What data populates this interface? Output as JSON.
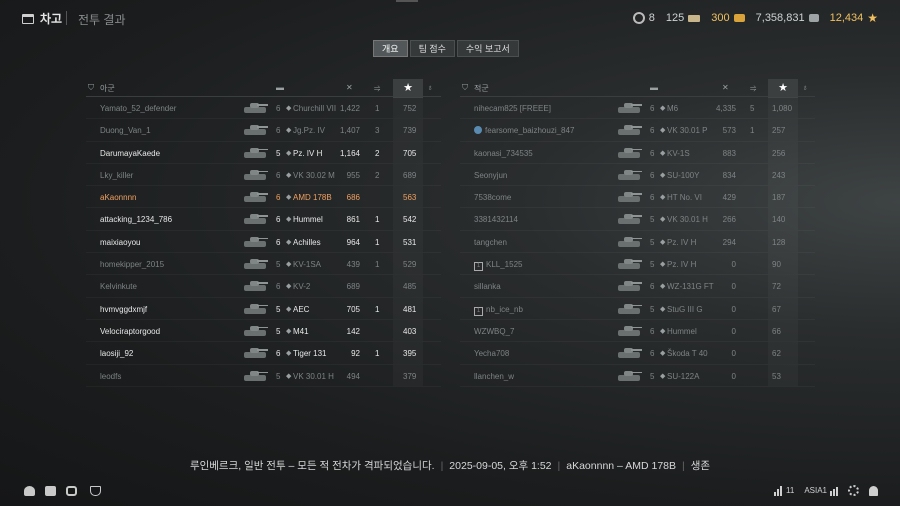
{
  "header": {
    "hangar_label": "차고",
    "breadcrumb": "전투 결과",
    "boosters": "8",
    "bonds": "125",
    "gold": "300",
    "credits": "7,358,831",
    "free_xp": "12,434"
  },
  "tabs": [
    {
      "label": "개요",
      "active": true
    },
    {
      "label": "팀 점수",
      "active": false
    },
    {
      "label": "수익 보고서",
      "active": false
    }
  ],
  "ally": {
    "title": "아군",
    "rows": [
      {
        "name": "Yamato_52_defender",
        "tier": "6",
        "tank": "Churchill VII",
        "damage": "1,422",
        "kills": "1",
        "xp": "752",
        "style": "dim"
      },
      {
        "name": "Duong_Van_1",
        "tier": "6",
        "tank": "Jg.Pz. IV",
        "damage": "1,407",
        "kills": "3",
        "xp": "739",
        "style": "dim"
      },
      {
        "name": "DarumayaKaede",
        "tier": "5",
        "tank": "Pz. IV H",
        "damage": "1,164",
        "kills": "2",
        "xp": "705",
        "style": "bright"
      },
      {
        "name": "Lky_killer",
        "tier": "6",
        "tank": "VK 30.02 M",
        "damage": "955",
        "kills": "2",
        "xp": "689",
        "style": "dim"
      },
      {
        "name": "aKaonnnn",
        "tier": "6",
        "tank": "AMD 178B",
        "damage": "686",
        "kills": "",
        "xp": "563",
        "style": "me"
      },
      {
        "name": "attacking_1234_786",
        "tier": "6",
        "tank": "Hummel",
        "damage": "861",
        "kills": "1",
        "xp": "542",
        "style": "bright"
      },
      {
        "name": "maixiaoyou",
        "tier": "6",
        "tank": "Achilles",
        "damage": "964",
        "kills": "1",
        "xp": "531",
        "style": "bright"
      },
      {
        "name": "homekipper_2015",
        "tier": "5",
        "tank": "KV-1SA",
        "damage": "439",
        "kills": "1",
        "xp": "529",
        "style": "dim"
      },
      {
        "name": "Kelvinkute",
        "tier": "6",
        "tank": "KV-2",
        "damage": "689",
        "kills": "",
        "xp": "485",
        "style": "dim"
      },
      {
        "name": "hvmvggdxmjf",
        "tier": "5",
        "tank": "AEC",
        "damage": "705",
        "kills": "1",
        "xp": "481",
        "style": "bright"
      },
      {
        "name": "Velociraptorgood",
        "tier": "5",
        "tank": "M41",
        "damage": "142",
        "kills": "",
        "xp": "403",
        "style": "bright"
      },
      {
        "name": "laosiji_92",
        "tier": "6",
        "tank": "Tiger 131",
        "damage": "92",
        "kills": "1",
        "xp": "395",
        "style": "bright"
      },
      {
        "name": "leodfs",
        "tier": "5",
        "tank": "VK 30.01 H",
        "damage": "494",
        "kills": "",
        "xp": "379",
        "style": "dim"
      }
    ]
  },
  "enemy": {
    "title": "적군",
    "rows": [
      {
        "name": "nihecam825 [FREEE]",
        "tier": "6",
        "tank": "M6",
        "damage": "4,335",
        "kills": "5",
        "xp": "1,080",
        "badge": "",
        "style": "dim"
      },
      {
        "name": "fearsome_baizhouzi_847",
        "tier": "6",
        "tank": "VK 30.01 P",
        "damage": "573",
        "kills": "1",
        "xp": "257",
        "badge": "clan",
        "style": "dim"
      },
      {
        "name": "kaonasi_734535",
        "tier": "6",
        "tank": "KV-1S",
        "damage": "883",
        "kills": "",
        "xp": "256",
        "badge": "",
        "style": "dim"
      },
      {
        "name": "Seonyjun",
        "tier": "6",
        "tank": "SU-100Y",
        "damage": "834",
        "kills": "",
        "xp": "243",
        "badge": "",
        "style": "dim"
      },
      {
        "name": "7538come",
        "tier": "6",
        "tank": "HT No. VI",
        "damage": "429",
        "kills": "",
        "xp": "187",
        "badge": "",
        "style": "dim"
      },
      {
        "name": "3381432114",
        "tier": "5",
        "tank": "VK 30.01 H",
        "damage": "266",
        "kills": "",
        "xp": "140",
        "badge": "",
        "style": "dim"
      },
      {
        "name": "tangchen",
        "tier": "5",
        "tank": "Pz. IV H",
        "damage": "294",
        "kills": "",
        "xp": "128",
        "badge": "",
        "style": "dim"
      },
      {
        "name": "KLL_1525",
        "tier": "5",
        "tank": "Pz. IV H",
        "damage": "0",
        "kills": "",
        "xp": "90",
        "badge": "square",
        "style": "dim"
      },
      {
        "name": "sillanka",
        "tier": "6",
        "tank": "WZ-131G FT",
        "damage": "0",
        "kills": "",
        "xp": "72",
        "badge": "",
        "style": "dim"
      },
      {
        "name": "nb_ice_nb",
        "tier": "5",
        "tank": "StuG III G",
        "damage": "0",
        "kills": "",
        "xp": "67",
        "badge": "square",
        "style": "dim"
      },
      {
        "name": "WZWBQ_7",
        "tier": "6",
        "tank": "Hummel",
        "damage": "0",
        "kills": "",
        "xp": "66",
        "badge": "",
        "style": "dim"
      },
      {
        "name": "Yecha708",
        "tier": "6",
        "tank": "Škoda T 40",
        "damage": "0",
        "kills": "",
        "xp": "62",
        "badge": "",
        "style": "dim"
      },
      {
        "name": "llanchen_w",
        "tier": "5",
        "tank": "SU-122A",
        "damage": "0",
        "kills": "",
        "xp": "53",
        "badge": "",
        "style": "dim"
      }
    ]
  },
  "summary": {
    "battle": "루인베르크, 일반 전투 – 모든 적 전차가 격파되었습니다.",
    "datetime": "2025-09-05, 오후 1:52",
    "player": "aKaonnnn – AMD 178B",
    "status": "생존"
  },
  "footer": {
    "ping": "11",
    "server": "ASIA1"
  }
}
